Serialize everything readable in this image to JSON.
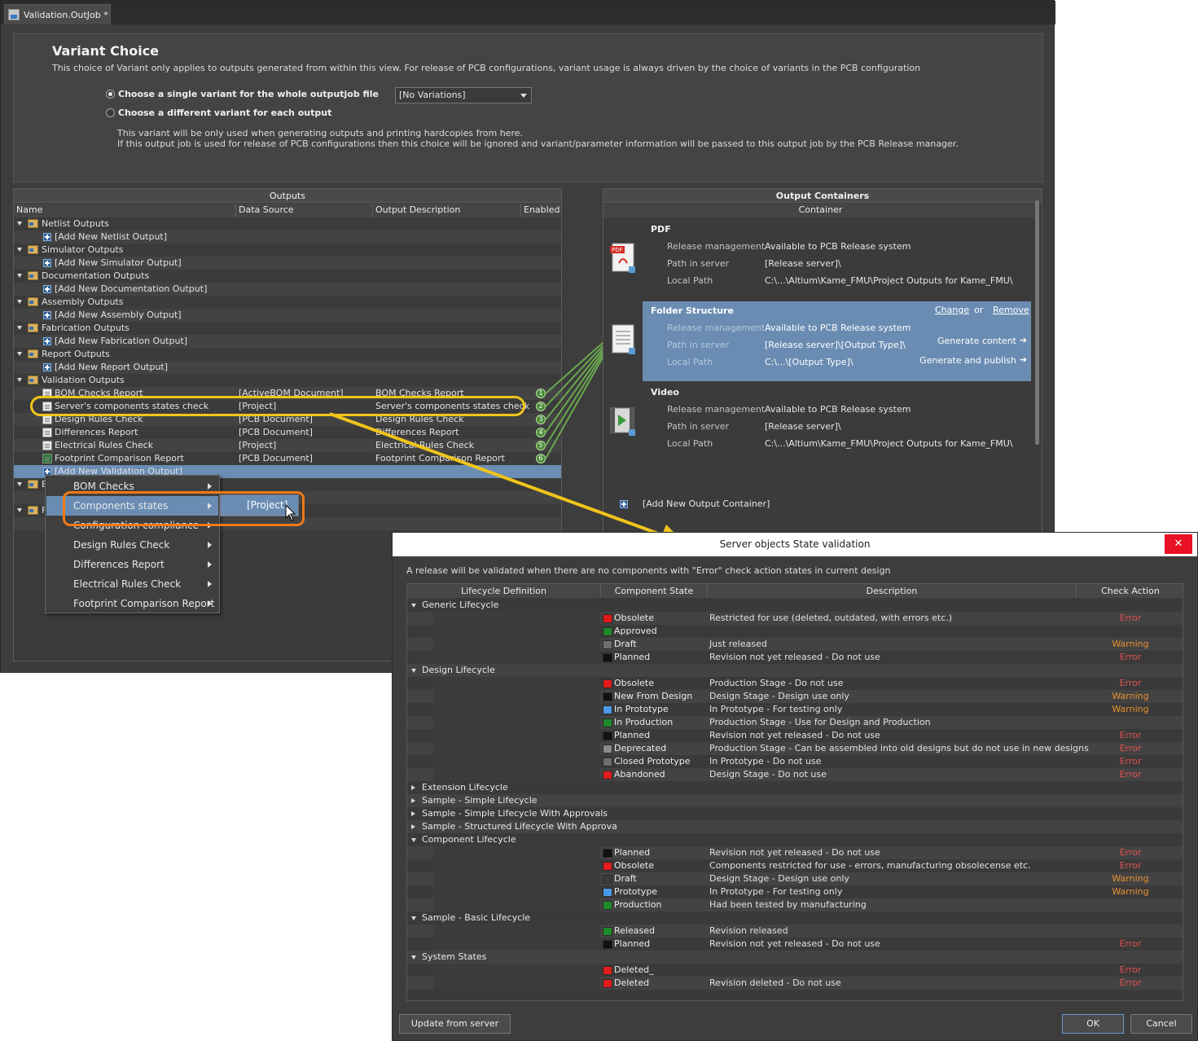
{
  "tab": {
    "title": "Validation.OutJob *"
  },
  "variant": {
    "heading": "Variant Choice",
    "description": "This choice of Variant only applies to outputs generated from within this view. For release of PCB configurations, variant usage is always driven by the choice of variants in the PCB configuration",
    "option_single": "Choose a single variant for the whole outputjob file",
    "option_each": "Choose a different variant for each output",
    "select_value": "[No Variations]",
    "note1": "This variant will be only used when generating outputs and printing hardcopies from here.",
    "note2": "If this output job is used for release of PCB configurations then this choice will be ignored and variant/parameter information will be passed to this output job by the PCB Release manager."
  },
  "outputs": {
    "title": "Outputs",
    "columns": [
      "Name",
      "Data Source",
      "Output Description",
      "Enabled"
    ],
    "rows": [
      {
        "kind": "group",
        "name": "Netlist Outputs"
      },
      {
        "kind": "add",
        "name": "[Add New Netlist Output]"
      },
      {
        "kind": "group",
        "name": "Simulator Outputs"
      },
      {
        "kind": "add",
        "name": "[Add New Simulator Output]"
      },
      {
        "kind": "group",
        "name": "Documentation Outputs"
      },
      {
        "kind": "add",
        "name": "[Add New Documentation Output]"
      },
      {
        "kind": "group",
        "name": "Assembly Outputs"
      },
      {
        "kind": "add",
        "name": "[Add New Assembly Output]"
      },
      {
        "kind": "group",
        "name": "Fabrication Outputs"
      },
      {
        "kind": "add",
        "name": "[Add New Fabrication Output]"
      },
      {
        "kind": "group",
        "name": "Report Outputs"
      },
      {
        "kind": "add",
        "name": "[Add New Report Output]"
      },
      {
        "kind": "group",
        "name": "Validation Outputs"
      },
      {
        "kind": "item",
        "name": "BOM Checks Report",
        "source": "[ActiveBOM Document]",
        "desc": "BOM Checks Report",
        "num": "1"
      },
      {
        "kind": "item",
        "name": "Server's components states check",
        "source": "[Project]",
        "desc": "Server's components states check",
        "num": "2"
      },
      {
        "kind": "item",
        "name": "Design Rules Check",
        "source": "[PCB Document]",
        "desc": "Design Rules Check",
        "num": "3"
      },
      {
        "kind": "item",
        "name": "Differences Report",
        "source": "[PCB Document]",
        "desc": "Differences Report",
        "num": "4"
      },
      {
        "kind": "item",
        "name": "Electrical Rules Check",
        "source": "[Project]",
        "desc": "Electrical Rules Check",
        "num": "5"
      },
      {
        "kind": "item",
        "name": "Footprint Comparison Report",
        "source": "[PCB Document]",
        "desc": "Footprint Comparison Report",
        "num": "6"
      },
      {
        "kind": "addsel",
        "name": "[Add New Validation Output]"
      },
      {
        "kind": "group",
        "name": "E"
      },
      {
        "kind": "blank",
        "name": ""
      },
      {
        "kind": "group",
        "name": "F"
      },
      {
        "kind": "blank",
        "name": ""
      }
    ]
  },
  "context_menu": {
    "items": [
      "BOM Checks",
      "Components states",
      "Configuration compliance",
      "Design Rules Check",
      "Differences Report",
      "Electrical Rules Check",
      "Footprint Comparison Report"
    ],
    "submenu_item": "[Project]"
  },
  "containers": {
    "title": "Output Containers",
    "column": "Container",
    "keys": [
      "Release management",
      "Path in server",
      "Local Path"
    ],
    "items": [
      {
        "name": "PDF",
        "release": "Available to PCB Release system",
        "server": "[Release server]\\",
        "local": "C:\\...\\Altium\\Kame_FMU\\Project Outputs for Kame_FMU\\"
      },
      {
        "name": "Folder Structure",
        "release": "Available to PCB Release system",
        "server": "[Release server]\\[Output Type]\\",
        "local": "C:\\...\\[Output Type]\\"
      },
      {
        "name": "Video",
        "release": "Available to PCB Release system",
        "server": "[Release server]\\",
        "local": "C:\\...\\Altium\\Kame_FMU\\Project Outputs for Kame_FMU\\"
      }
    ],
    "change": "Change",
    "or": "or",
    "remove": "Remove",
    "generate_content": "Generate content",
    "generate_publish": "Generate and publish",
    "add_container": "[Add New Output Container]"
  },
  "dialog": {
    "title": "Server objects State validation",
    "close": "✕",
    "info": "A release will be validated when there are no components with \"Error\" check action states in current design",
    "columns": [
      "Lifecycle Definition",
      "Component State",
      "Description",
      "Check Action"
    ],
    "rows": [
      {
        "kind": "group",
        "name": "Generic Lifecycle",
        "open": true
      },
      {
        "kind": "state",
        "name": "Obsolete",
        "color": "#e21b1b",
        "desc": "Restricted for use (deleted, outdated, with errors etc.)",
        "action": "Error"
      },
      {
        "kind": "state",
        "name": "Approved",
        "color": "#1e8a2a",
        "desc": "",
        "action": ""
      },
      {
        "kind": "state",
        "name": "Draft",
        "color": "#6e6e6e",
        "desc": "Just released",
        "action": "Warning"
      },
      {
        "kind": "state",
        "name": "Planned",
        "color": "#111111",
        "desc": "Revision not yet released - Do not use",
        "action": "Error"
      },
      {
        "kind": "group",
        "name": "Design Lifecycle",
        "open": true
      },
      {
        "kind": "state",
        "name": "Obsolete",
        "color": "#e21b1b",
        "desc": "Production Stage - Do not use",
        "action": "Error"
      },
      {
        "kind": "state",
        "name": "New From Design",
        "color": "#111111",
        "desc": "Design Stage - Design use only",
        "action": "Warning"
      },
      {
        "kind": "state",
        "name": "In Prototype",
        "color": "#4a9ae8",
        "desc": "In Prototype - For testing only",
        "action": "Warning"
      },
      {
        "kind": "state",
        "name": "In Production",
        "color": "#1e8a2a",
        "desc": "Production Stage - Use for Design and Production",
        "action": ""
      },
      {
        "kind": "state",
        "name": "Planned",
        "color": "#111111",
        "desc": "Revision not yet released - Do not use",
        "action": "Error"
      },
      {
        "kind": "state",
        "name": "Deprecated",
        "color": "#8a8a8a",
        "desc": "Production Stage - Can be assembled into old designs but do not use in new designs",
        "action": "Error"
      },
      {
        "kind": "state",
        "name": "Closed Prototype",
        "color": "#6e6e6e",
        "desc": "In Prototype - Do not use",
        "action": "Error"
      },
      {
        "kind": "state",
        "name": "Abandoned",
        "color": "#e21b1b",
        "desc": "Design Stage - Do not use",
        "action": "Error"
      },
      {
        "kind": "group",
        "name": "Extension Lifecycle",
        "open": false
      },
      {
        "kind": "group",
        "name": "Sample - Simple Lifecycle",
        "open": false
      },
      {
        "kind": "group",
        "name": "Sample - Simple Lifecycle With Approvals",
        "open": false
      },
      {
        "kind": "group",
        "name": "Sample - Structured Lifecycle With Approva",
        "open": false
      },
      {
        "kind": "group",
        "name": "Component Lifecycle",
        "open": true
      },
      {
        "kind": "state",
        "name": "Planned",
        "color": "#111111",
        "desc": "Revision not yet released - Do not use",
        "action": "Error"
      },
      {
        "kind": "state",
        "name": "Obsolete",
        "color": "#e21b1b",
        "desc": "Components restricted for use - errors, manufacturing obsolecense etc.",
        "action": "Error"
      },
      {
        "kind": "state",
        "name": "Draft",
        "color": "#3d3d3d",
        "desc": "Design Stage - Design use only",
        "action": "Warning"
      },
      {
        "kind": "state",
        "name": "Prototype",
        "color": "#4a9ae8",
        "desc": "In Prototype - For testing only",
        "action": "Warning"
      },
      {
        "kind": "state",
        "name": "Production",
        "color": "#1e8a2a",
        "desc": "Had been tested by manufacturing",
        "action": ""
      },
      {
        "kind": "group",
        "name": "Sample - Basic Lifecycle",
        "open": true
      },
      {
        "kind": "state",
        "name": "Released",
        "color": "#1e8a2a",
        "desc": "Revision released",
        "action": ""
      },
      {
        "kind": "state",
        "name": "Planned",
        "color": "#111111",
        "desc": "Revision not yet released - Do not use",
        "action": "Error"
      },
      {
        "kind": "group",
        "name": "System States",
        "open": true
      },
      {
        "kind": "state",
        "name": "Deleted_",
        "color": "#e21b1b",
        "desc": "",
        "action": "Error"
      },
      {
        "kind": "state",
        "name": "Deleted",
        "color": "#e21b1b",
        "desc": "Revision deleted - Do not use",
        "action": "Error"
      }
    ],
    "update_button": "Update from server",
    "ok_button": "OK",
    "cancel_button": "Cancel"
  },
  "colors": {
    "error": "#e0524f",
    "warning": "#e9902f",
    "highlight": "#6a8cb2",
    "callout_yellow": "#f0c41a",
    "callout_orange": "#ef7a1a"
  }
}
